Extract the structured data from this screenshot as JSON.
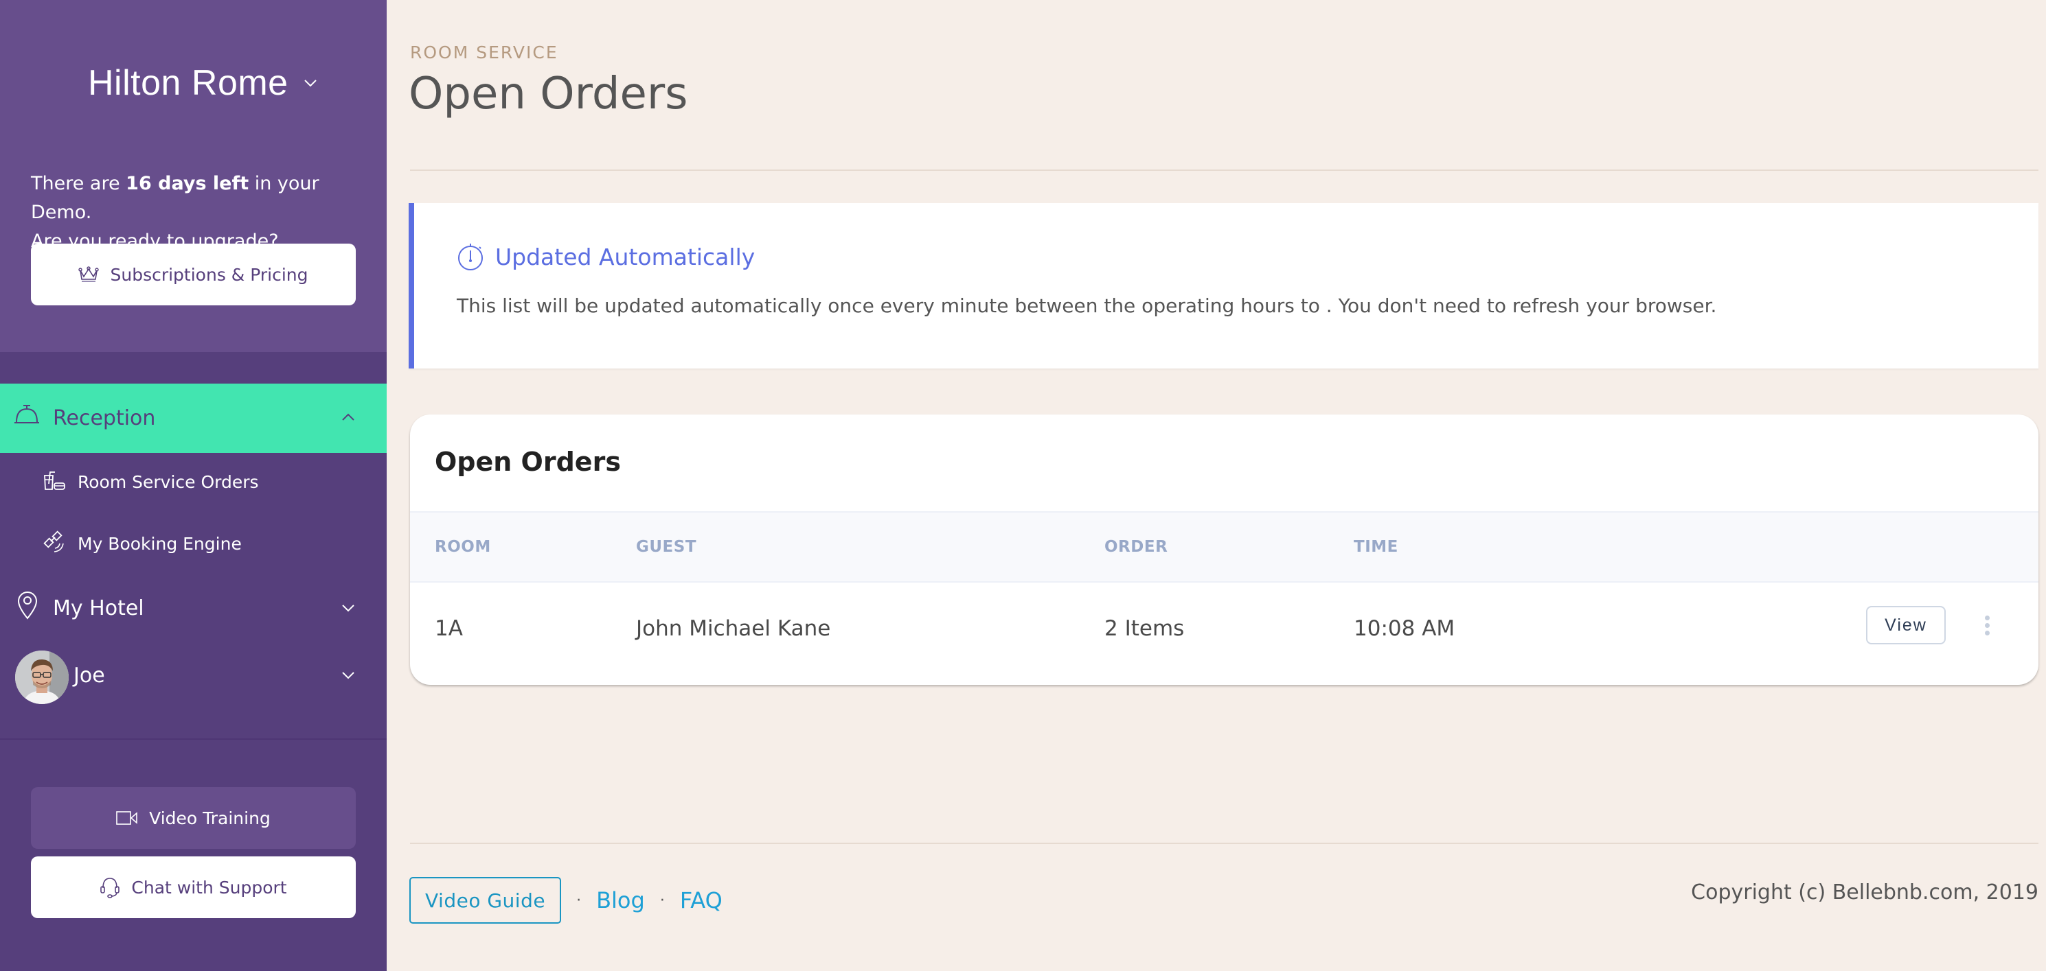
{
  "sidebar": {
    "hotel_name": "Hilton Rome",
    "demo_notice": {
      "prefix": "There are ",
      "highlight": "16 days left",
      "suffix": " in your Demo.",
      "line2": "Are you ready to upgrade?"
    },
    "subscriptions_button": {
      "label": "Subscriptions & Pricing",
      "icon": "crown-icon"
    },
    "nav": {
      "reception": {
        "label": "Reception",
        "icon": "service-bell-icon",
        "expanded": true
      },
      "reception_items": [
        {
          "label": "Room Service Orders",
          "icon": "drink-food-icon"
        },
        {
          "label": "My Booking Engine",
          "icon": "satellite-icon"
        }
      ],
      "my_hotel": {
        "label": "My Hotel",
        "icon": "map-pin-icon"
      },
      "user": {
        "label": "Joe"
      }
    },
    "video_training_button": {
      "label": "Video Training",
      "icon": "video-camera-icon"
    },
    "chat_support_button": {
      "label": "Chat with Support",
      "icon": "headset-icon"
    }
  },
  "header": {
    "eyebrow": "ROOM SERVICE",
    "title": "Open Orders"
  },
  "alert": {
    "title": "Updated Automatically",
    "icon": "stopwatch-icon",
    "text": "This list will be updated automatically once every minute between the operating hours to . You don't need to refresh your browser."
  },
  "orders_card": {
    "title": "Open Orders",
    "columns": [
      "ROOM",
      "GUEST",
      "ORDER",
      "TIME"
    ],
    "rows": [
      {
        "room": "1A",
        "guest": "John Michael Kane",
        "order": "2 Items",
        "time": "10:08 AM",
        "action": "View"
      }
    ]
  },
  "footer": {
    "video_guide": "Video Guide",
    "separator": "·",
    "blog": "Blog",
    "faq": "FAQ",
    "copyright": "Copyright (c) Bellebnb.com, 2019"
  },
  "colors": {
    "sidebar_bg": "#563f7c",
    "sidebar_top_bg": "#674e8c",
    "active_nav": "#42e5b0",
    "accent_blue": "#5b6ee1",
    "link_blue": "#1ea0d6",
    "page_bg": "#f6eee8"
  }
}
